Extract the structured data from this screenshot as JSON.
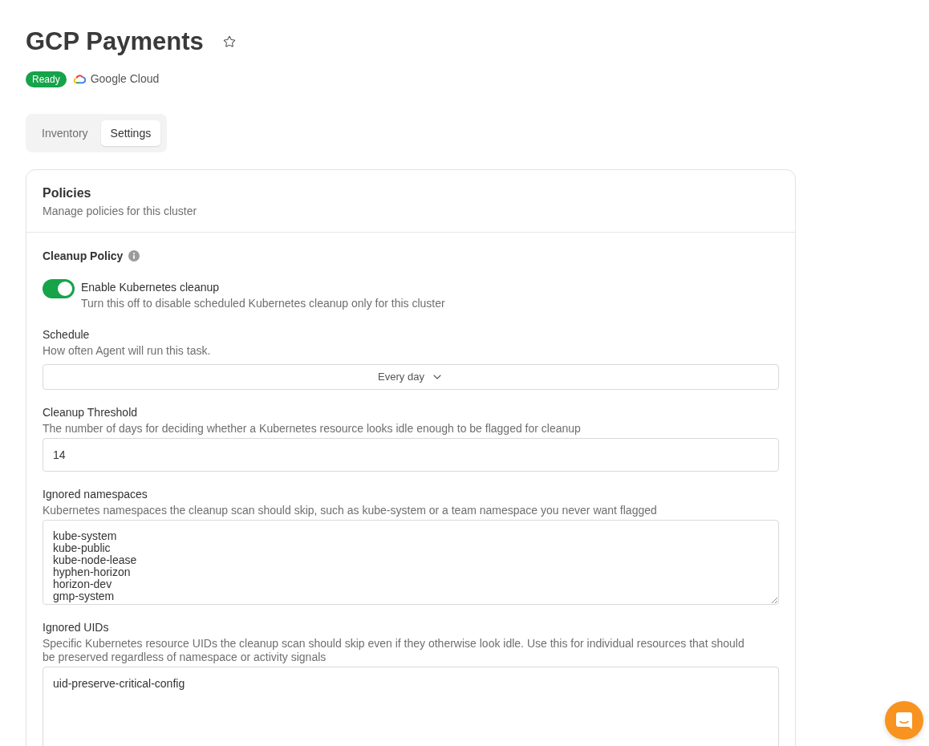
{
  "header": {
    "title": "GCP Payments",
    "favorite": false,
    "status_badge": "Ready",
    "provider": "Google Cloud"
  },
  "tabs": [
    {
      "label": "Inventory",
      "selected": false
    },
    {
      "label": "Settings",
      "selected": true
    }
  ],
  "policies_card": {
    "title": "Policies",
    "subtitle": "Manage policies for this cluster",
    "section_title": "Cleanup Policy",
    "toggle": {
      "label": "Enable Kubernetes cleanup",
      "description": "Turn this off to disable scheduled Kubernetes cleanup only for this cluster",
      "on": true
    },
    "fields": [
      {
        "kind": "select",
        "label": "Schedule",
        "description": "How often Agent will run this task.",
        "value": "Every day"
      },
      {
        "kind": "input",
        "label": "Cleanup Threshold",
        "description": "The number of days for deciding whether a Kubernetes resource looks idle enough to be flagged for cleanup",
        "value": "14"
      },
      {
        "kind": "textarea",
        "label": "Ignored namespaces",
        "description": "Kubernetes namespaces the cleanup scan should skip, such as kube-system or a team namespace you never want flagged",
        "lines": [
          "kube-system",
          "kube-public",
          "kube-node-lease",
          "hyphen-horizon",
          "horizon-dev",
          "gmp-system"
        ],
        "resizable": true
      },
      {
        "kind": "textarea",
        "label": "Ignored UIDs",
        "description": "Specific Kubernetes resource UIDs the cleanup scan should skip even if they otherwise look idle. Use this for individual resources that should be preserved regardless of namespace or activity signals",
        "lines": [
          "uid-preserve-critical-config"
        ],
        "resizable": false
      }
    ]
  }
}
